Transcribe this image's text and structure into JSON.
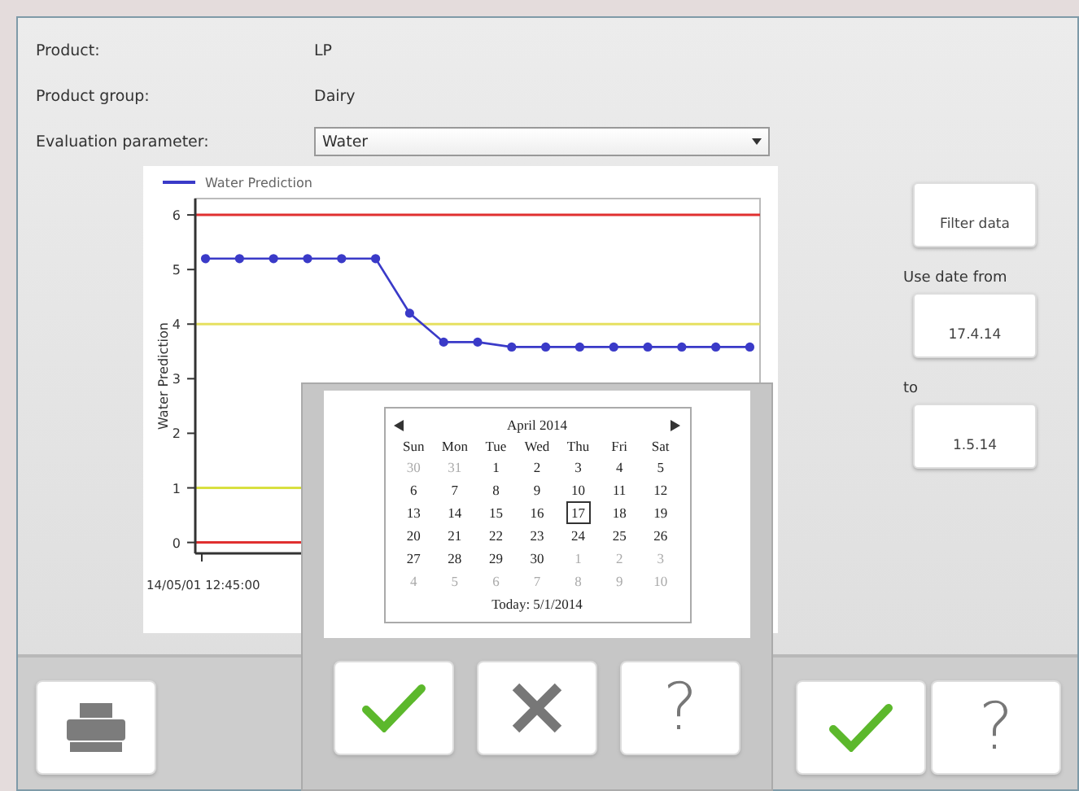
{
  "window": {
    "fields": [
      {
        "label": "Product:",
        "value": "LP",
        "kind": "text"
      },
      {
        "label": "Product group:",
        "value": "Dairy",
        "kind": "text"
      },
      {
        "label": "Evaluation parameter:",
        "value": "Water",
        "kind": "select"
      }
    ],
    "chart": {
      "chart_data": {
        "type": "line",
        "ylabel": "Water Prediction",
        "series": [
          {
            "name": "Water Prediction",
            "color": "#3a3ac8",
            "marker": "circle",
            "values": [
              5.2,
              5.2,
              5.2,
              5.2,
              5.2,
              5.2,
              4.2,
              3.67,
              3.67,
              3.58,
              3.58,
              3.58,
              3.58,
              3.58,
              3.58,
              3.58,
              3.58
            ]
          }
        ],
        "ylim": [
          -0.2,
          6.3
        ],
        "yticks": [
          {
            "value": 0,
            "label": "0"
          },
          {
            "value": 1,
            "label": "1"
          },
          {
            "value": 2,
            "label": "2"
          },
          {
            "value": 3,
            "label": "3"
          },
          {
            "value": 4,
            "label": "4"
          },
          {
            "value": 5,
            "label": "5"
          },
          {
            "value": 6,
            "label": "6"
          }
        ],
        "ref_lines": [
          {
            "axis": "y",
            "value": 6,
            "color": "#e03030"
          },
          {
            "axis": "y",
            "value": 4,
            "color": "#e6e060"
          },
          {
            "axis": "y",
            "value": 1,
            "color": "#d8e040"
          },
          {
            "axis": "y",
            "value": 0,
            "color": "#e03030"
          }
        ],
        "annotations": [
          {
            "text": "14/05/01 12:45:00"
          }
        ]
      }
    },
    "filter": {
      "button": "Filter data",
      "from_label": "Use date from",
      "from_value": "17.4.14",
      "to_label": "to",
      "to_value": "1.5.14"
    },
    "toolbar": [
      {
        "kind": "print"
      },
      {
        "kind": "confirm"
      },
      {
        "kind": "help",
        "label": "?"
      }
    ]
  },
  "dialog": {
    "calendar": {
      "title": "April 2014",
      "weekdays": [
        "Sun",
        "Mon",
        "Tue",
        "Wed",
        "Thu",
        "Fri",
        "Sat"
      ],
      "days": [
        {
          "label": "30",
          "in_month": false,
          "selected": false
        },
        {
          "label": "31",
          "in_month": false,
          "selected": false
        },
        {
          "label": "1",
          "in_month": true,
          "selected": false
        },
        {
          "label": "2",
          "in_month": true,
          "selected": false
        },
        {
          "label": "3",
          "in_month": true,
          "selected": false
        },
        {
          "label": "4",
          "in_month": true,
          "selected": false
        },
        {
          "label": "5",
          "in_month": true,
          "selected": false
        },
        {
          "label": "6",
          "in_month": true,
          "selected": false
        },
        {
          "label": "7",
          "in_month": true,
          "selected": false
        },
        {
          "label": "8",
          "in_month": true,
          "selected": false
        },
        {
          "label": "9",
          "in_month": true,
          "selected": false
        },
        {
          "label": "10",
          "in_month": true,
          "selected": false
        },
        {
          "label": "11",
          "in_month": true,
          "selected": false
        },
        {
          "label": "12",
          "in_month": true,
          "selected": false
        },
        {
          "label": "13",
          "in_month": true,
          "selected": false
        },
        {
          "label": "14",
          "in_month": true,
          "selected": false
        },
        {
          "label": "15",
          "in_month": true,
          "selected": false
        },
        {
          "label": "16",
          "in_month": true,
          "selected": false
        },
        {
          "label": "17",
          "in_month": true,
          "selected": true
        },
        {
          "label": "18",
          "in_month": true,
          "selected": false
        },
        {
          "label": "19",
          "in_month": true,
          "selected": false
        },
        {
          "label": "20",
          "in_month": true,
          "selected": false
        },
        {
          "label": "21",
          "in_month": true,
          "selected": false
        },
        {
          "label": "22",
          "in_month": true,
          "selected": false
        },
        {
          "label": "23",
          "in_month": true,
          "selected": false
        },
        {
          "label": "24",
          "in_month": true,
          "selected": false
        },
        {
          "label": "25",
          "in_month": true,
          "selected": false
        },
        {
          "label": "26",
          "in_month": true,
          "selected": false
        },
        {
          "label": "27",
          "in_month": true,
          "selected": false
        },
        {
          "label": "28",
          "in_month": true,
          "selected": false
        },
        {
          "label": "29",
          "in_month": true,
          "selected": false
        },
        {
          "label": "30",
          "in_month": true,
          "selected": false
        },
        {
          "label": "1",
          "in_month": false,
          "selected": false
        },
        {
          "label": "2",
          "in_month": false,
          "selected": false
        },
        {
          "label": "3",
          "in_month": false,
          "selected": false
        },
        {
          "label": "4",
          "in_month": false,
          "selected": false
        },
        {
          "label": "5",
          "in_month": false,
          "selected": false
        },
        {
          "label": "6",
          "in_month": false,
          "selected": false
        },
        {
          "label": "7",
          "in_month": false,
          "selected": false
        },
        {
          "label": "8",
          "in_month": false,
          "selected": false
        },
        {
          "label": "9",
          "in_month": false,
          "selected": false
        },
        {
          "label": "10",
          "in_month": false,
          "selected": false
        }
      ],
      "today": "Today: 5/1/2014"
    },
    "buttons": [
      {
        "kind": "confirm"
      },
      {
        "kind": "cancel"
      },
      {
        "kind": "help",
        "label": "?"
      }
    ]
  }
}
